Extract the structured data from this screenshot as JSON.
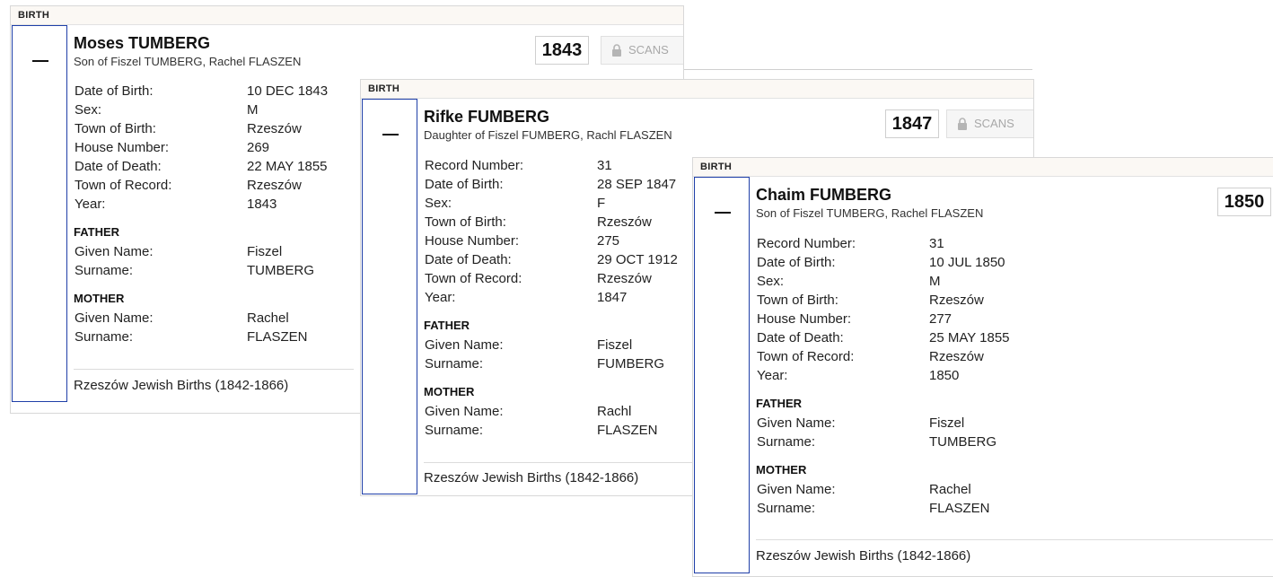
{
  "cards": [
    {
      "tag": "BIRTH",
      "name": "Moses TUMBERG",
      "relation": "Son of Fiszel TUMBERG, Rachel FLASZEN",
      "year": "1843",
      "scans": "SCANS",
      "fields": [
        {
          "label": "Date of Birth:",
          "value": "10 DEC 1843"
        },
        {
          "label": "Sex:",
          "value": "M"
        },
        {
          "label": "Town of Birth:",
          "value": "Rzeszów"
        },
        {
          "label": "House Number:",
          "value": "269"
        },
        {
          "label": "Date of Death:",
          "value": "22 MAY 1855"
        },
        {
          "label": "Town of Record:",
          "value": "Rzeszów"
        },
        {
          "label": "Year:",
          "value": "1843"
        }
      ],
      "father": {
        "heading": "FATHER",
        "given_label": "Given Name:",
        "given": "Fiszel",
        "surname_label": "Surname:",
        "surname": "TUMBERG"
      },
      "mother": {
        "heading": "MOTHER",
        "given_label": "Given Name:",
        "given": "Rachel",
        "surname_label": "Surname:",
        "surname": "FLASZEN"
      },
      "source": "Rzeszów Jewish Births (1842-1866)"
    },
    {
      "tag": "BIRTH",
      "name": "Rifke FUMBERG",
      "relation": "Daughter of Fiszel FUMBERG, Rachl FLASZEN",
      "year": "1847",
      "scans": "SCANS",
      "fields": [
        {
          "label": "Record Number:",
          "value": "31"
        },
        {
          "label": "Date of Birth:",
          "value": "28 SEP 1847"
        },
        {
          "label": "Sex:",
          "value": "F"
        },
        {
          "label": "Town of Birth:",
          "value": "Rzeszów"
        },
        {
          "label": "House Number:",
          "value": "275"
        },
        {
          "label": "Date of Death:",
          "value": "29 OCT 1912"
        },
        {
          "label": "Town of Record:",
          "value": "Rzeszów"
        },
        {
          "label": "Year:",
          "value": "1847"
        }
      ],
      "father": {
        "heading": "FATHER",
        "given_label": "Given Name:",
        "given": "Fiszel",
        "surname_label": "Surname:",
        "surname": "FUMBERG"
      },
      "mother": {
        "heading": "MOTHER",
        "given_label": "Given Name:",
        "given": "Rachl",
        "surname_label": "Surname:",
        "surname": "FLASZEN"
      },
      "source": "Rzeszów Jewish Births (1842-1866)"
    },
    {
      "tag": "BIRTH",
      "name": "Chaim FUMBERG",
      "relation": "Son of Fiszel TUMBERG, Rachel FLASZEN",
      "year": "1850",
      "fields": [
        {
          "label": "Record Number:",
          "value": "31"
        },
        {
          "label": "Date of Birth:",
          "value": "10 JUL 1850"
        },
        {
          "label": "Sex:",
          "value": "M"
        },
        {
          "label": "Town of Birth:",
          "value": "Rzeszów"
        },
        {
          "label": "House Number:",
          "value": "277"
        },
        {
          "label": "Date of Death:",
          "value": "25 MAY 1855"
        },
        {
          "label": "Town of Record:",
          "value": "Rzeszów"
        },
        {
          "label": "Year:",
          "value": "1850"
        }
      ],
      "father": {
        "heading": "FATHER",
        "given_label": "Given Name:",
        "given": "Fiszel",
        "surname_label": "Surname:",
        "surname": "TUMBERG"
      },
      "mother": {
        "heading": "MOTHER",
        "given_label": "Given Name:",
        "given": "Rachel",
        "surname_label": "Surname:",
        "surname": "FLASZEN"
      },
      "source": "Rzeszów Jewish Births (1842-1866)"
    }
  ],
  "icons": {
    "scans": "lock-icon",
    "expand": "dash-icon"
  }
}
